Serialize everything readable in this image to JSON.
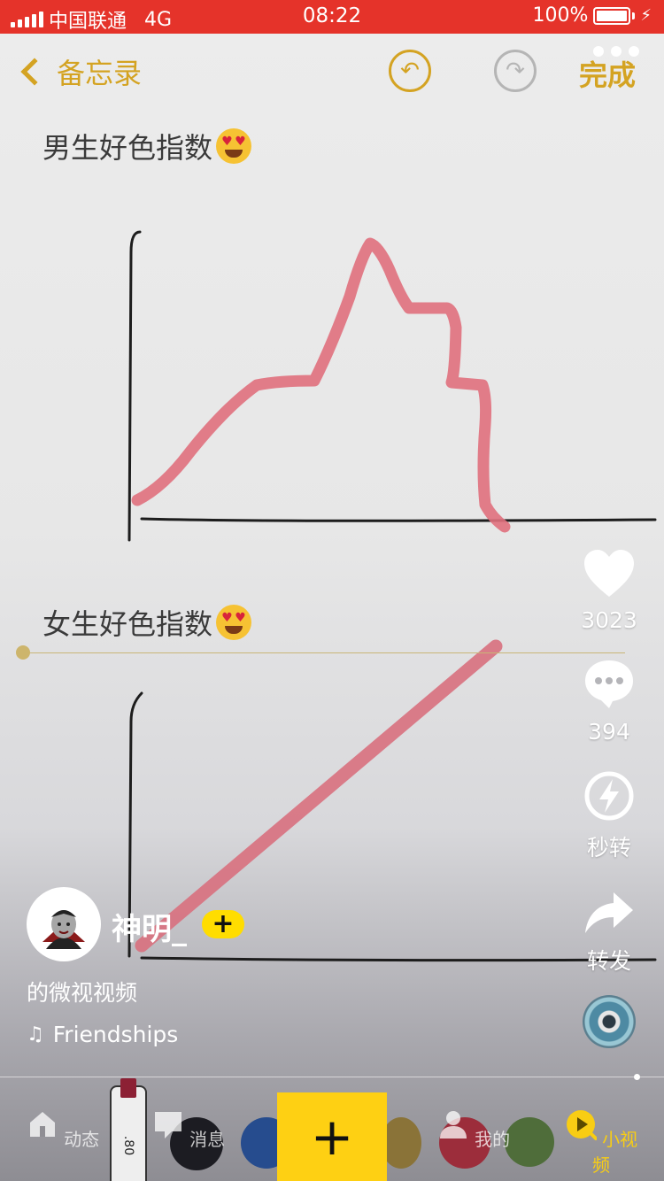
{
  "status_bar": {
    "carrier": "中国联通",
    "network": "4G",
    "time": "08:22",
    "battery": "100%"
  },
  "notes_header": {
    "back_label": "备忘录",
    "done_label": "完成"
  },
  "note": {
    "heading_male": "男生好色指数",
    "heading_female": "女生好色指数"
  },
  "actions": {
    "like_count": "3023",
    "comment_count": "394",
    "quick_share_label": "秒转",
    "forward_label": "转发"
  },
  "author": {
    "name": "神明_",
    "follow_label": "+",
    "description": "的微视视频",
    "music_title": "Friendships"
  },
  "tabbar": {
    "tabs": [
      {
        "label": "动态"
      },
      {
        "label": "消息"
      },
      {
        "label": "我的"
      },
      {
        "label": "小视频"
      }
    ],
    "create_label": "+"
  },
  "colors": {
    "status_red": "#e5332a",
    "accent_gold": "#d4a322",
    "tab_active": "#f8cd14",
    "create_yellow": "#fed013"
  }
}
